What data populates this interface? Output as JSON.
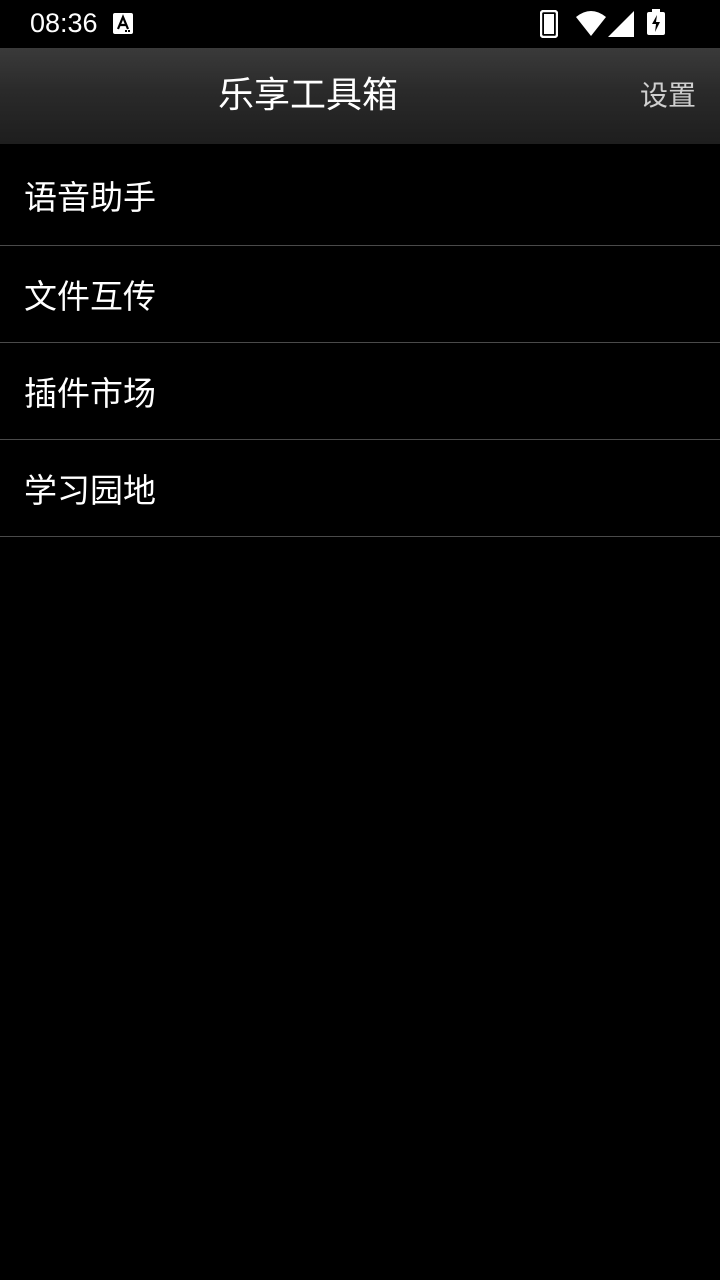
{
  "status_bar": {
    "time": "08:36",
    "icons": [
      "text-input-a-icon",
      "phone-icon",
      "wifi-icon",
      "cell-signal-icon",
      "battery-charging-icon"
    ]
  },
  "action_bar": {
    "title": "乐享工具箱",
    "settings_label": "设置"
  },
  "menu": {
    "items": [
      {
        "label": "语音助手"
      },
      {
        "label": "文件互传"
      },
      {
        "label": "插件市场"
      },
      {
        "label": "学习园地"
      }
    ]
  },
  "colors": {
    "background": "#000000",
    "action_bar": "#2a2a2a",
    "divider": "#4a4a4a",
    "settings_text": "#cfcfcf"
  }
}
